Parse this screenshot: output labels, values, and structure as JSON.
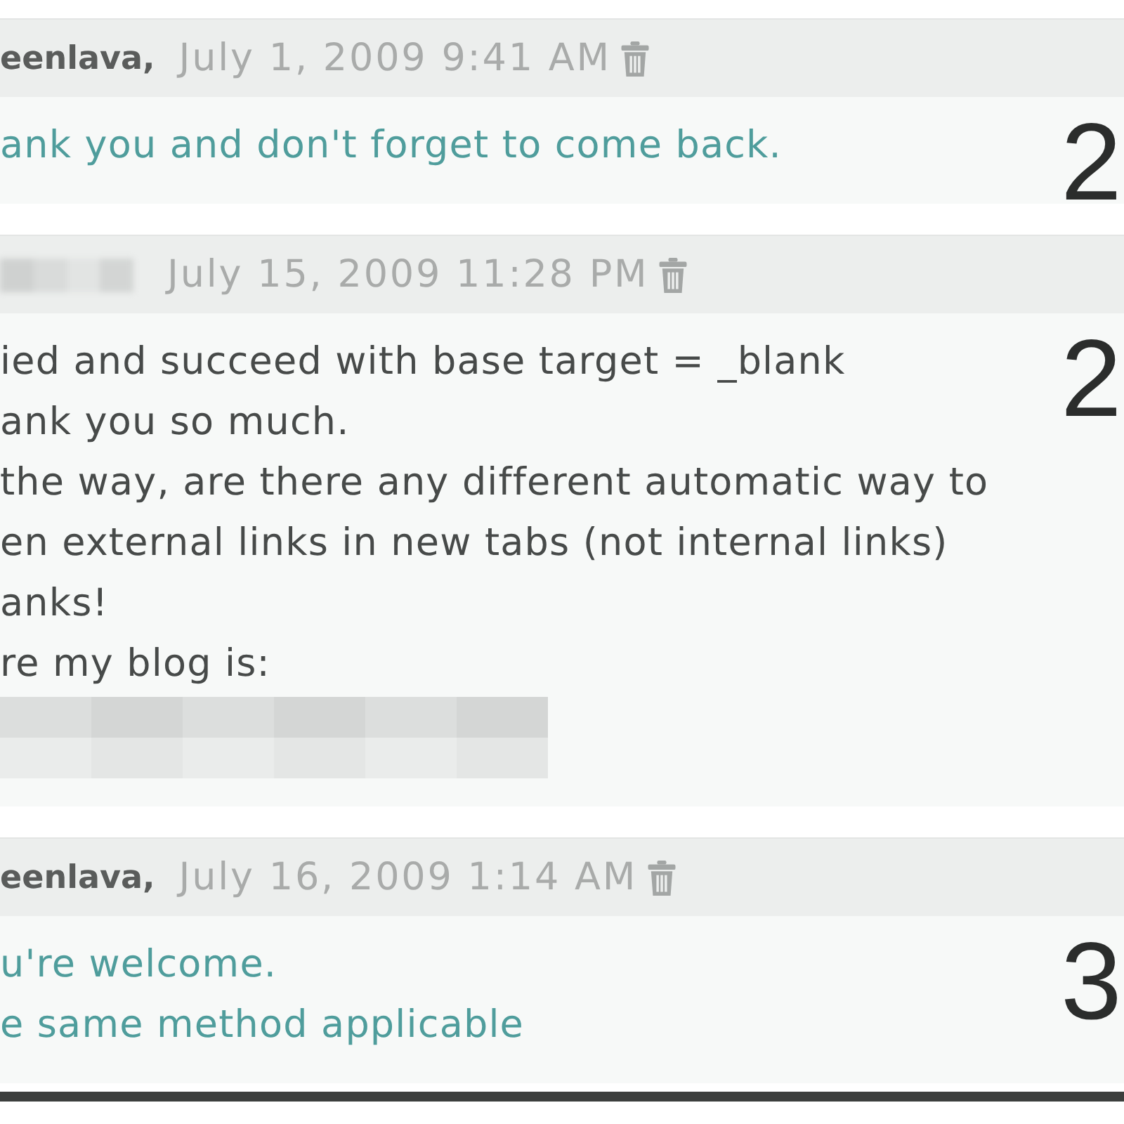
{
  "comments": [
    {
      "kind": "reply",
      "author_redacted": false,
      "author": "eenlava,",
      "date": "July 1, 2009 9:41 AM",
      "lines": [
        {
          "kind": "text",
          "text": "ank you and don't forget to come back."
        }
      ],
      "number": "2"
    },
    {
      "kind": "visitor",
      "author_redacted": true,
      "date": "July 15, 2009 11:28 PM",
      "lines": [
        {
          "kind": "text",
          "text": "ied and succeed with base target = _blank"
        },
        {
          "kind": "text",
          "text": "ank you so much."
        },
        {
          "kind": "text",
          "text": "the way, are there any different automatic way to"
        },
        {
          "kind": "text",
          "text": "en external links in new tabs (not internal links)"
        },
        {
          "kind": "text",
          "text": "anks!"
        },
        {
          "kind": "text",
          "text": "re my blog is:"
        },
        {
          "kind": "redacted"
        }
      ],
      "number": "2"
    },
    {
      "kind": "reply",
      "author_redacted": false,
      "author": "eenlava,",
      "date": "July 16, 2009 1:14 AM",
      "lines": [
        {
          "kind": "text",
          "text": "u're welcome."
        },
        {
          "kind": "text",
          "text": "e same method applicable"
        }
      ],
      "number": "3"
    }
  ]
}
